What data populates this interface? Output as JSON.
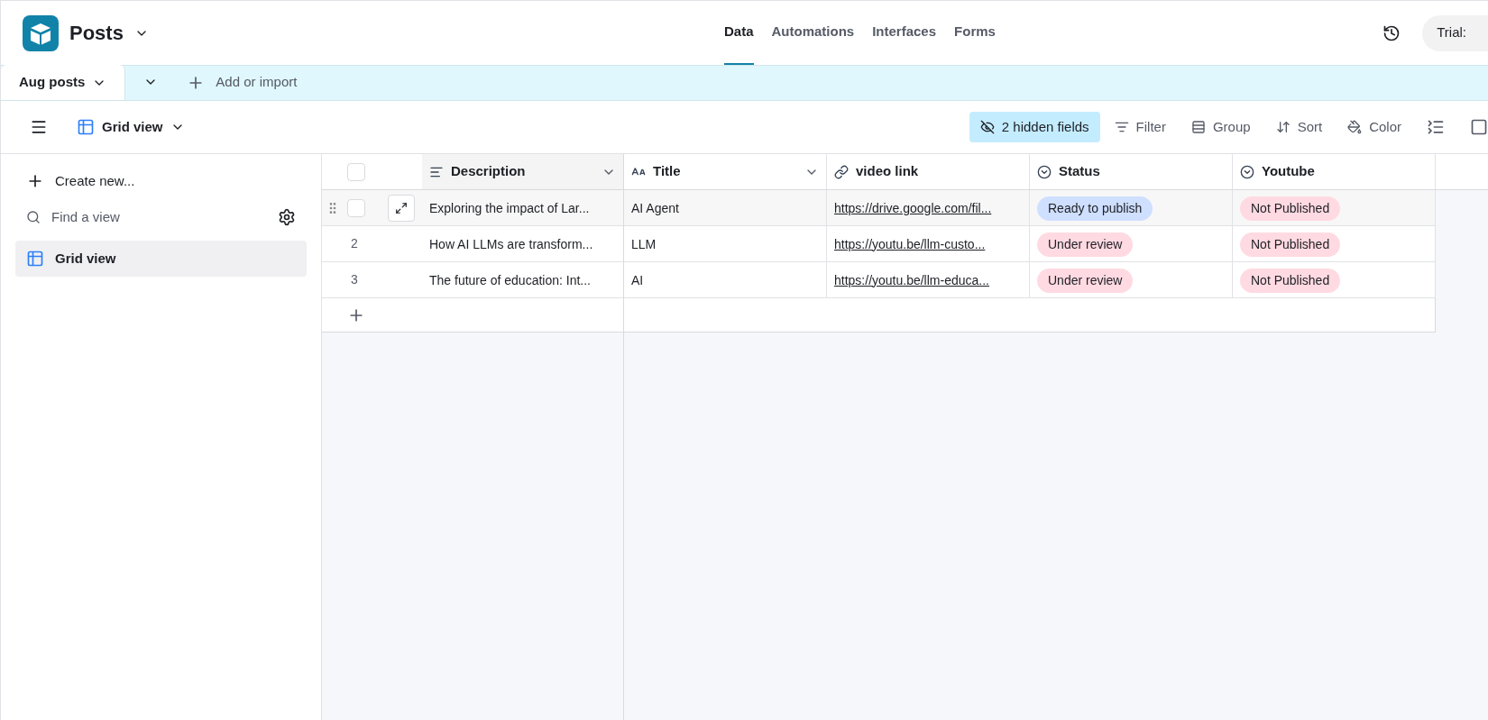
{
  "base": {
    "name": "Posts"
  },
  "nav_tabs": [
    {
      "label": "Data",
      "selected": true
    },
    {
      "label": "Automations",
      "selected": false
    },
    {
      "label": "Interfaces",
      "selected": false
    },
    {
      "label": "Forms",
      "selected": false
    }
  ],
  "trial": {
    "label": "Trial:"
  },
  "table_tabs": [
    {
      "label": "Aug posts",
      "selected": true
    }
  ],
  "add_import": {
    "label": "Add or import"
  },
  "view": {
    "name": "Grid view"
  },
  "toolbar": [
    {
      "kind": "hidden",
      "label": "2 hidden fields",
      "active": true
    },
    {
      "kind": "filter",
      "label": "Filter",
      "active": false
    },
    {
      "kind": "group",
      "label": "Group",
      "active": false
    },
    {
      "kind": "sort",
      "label": "Sort",
      "active": false
    },
    {
      "kind": "color",
      "label": "Color",
      "active": false
    }
  ],
  "sidebar": {
    "create": "Create new...",
    "search": {
      "placeholder": "Find a view"
    },
    "items": [
      {
        "label": "Grid view",
        "selected": true
      }
    ]
  },
  "table": {
    "select_all": {
      "checked": false
    },
    "columns": [
      {
        "kind": "text",
        "label": "Description"
      },
      {
        "kind": "title",
        "label": "Title"
      },
      {
        "kind": "link",
        "label": "video link"
      },
      {
        "kind": "select",
        "label": "Status"
      },
      {
        "kind": "select",
        "label": "Youtube"
      }
    ],
    "rows": [
      {
        "hovered": true,
        "checked": false,
        "cells": [
          "Exploring the impact of Lar...",
          "AI Agent",
          "https://drive.google.com/fil...",
          {
            "label": "Ready to publish",
            "color": "#cfdfff"
          },
          {
            "label": "Not Published",
            "color": "#ffdae2"
          }
        ]
      },
      {
        "hovered": false,
        "number": "2",
        "cells": [
          "How AI LLMs are transform...",
          "LLM",
          "https://youtu.be/llm-custo...",
          {
            "label": "Under review",
            "color": "#ffdae2"
          },
          {
            "label": "Not Published",
            "color": "#ffdae2"
          }
        ]
      },
      {
        "hovered": false,
        "number": "3",
        "cells": [
          "The future of education: Int...",
          "AI",
          "https://youtu.be/llm-educa...",
          {
            "label": "Under review",
            "color": "#ffdae2"
          },
          {
            "label": "Not Published",
            "color": "#ffdae2"
          }
        ]
      }
    ]
  }
}
